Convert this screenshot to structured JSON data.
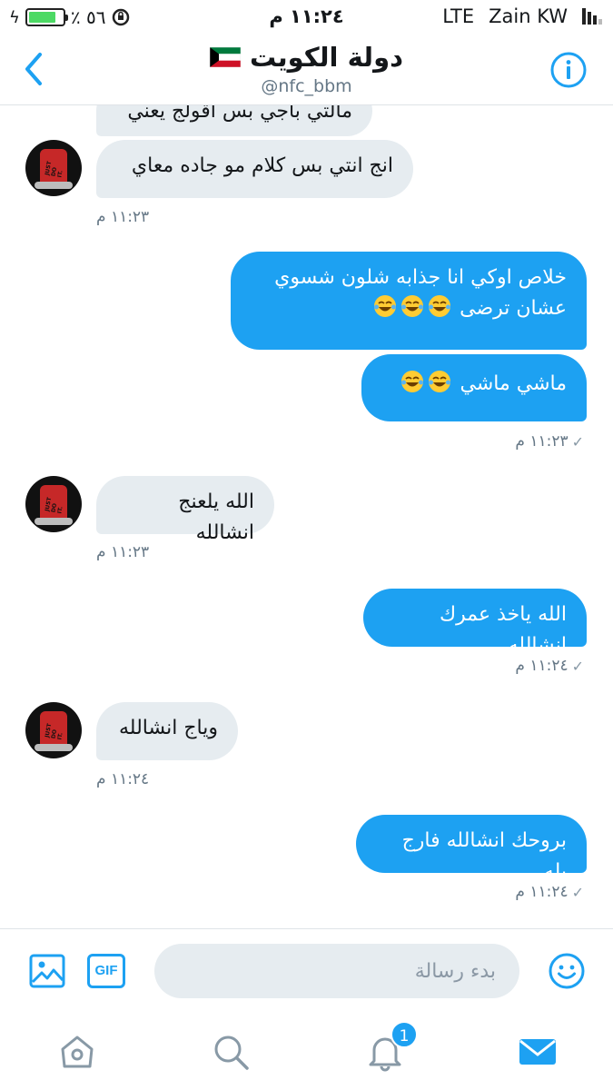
{
  "status_bar": {
    "battery_percent": "٪ ٥٦",
    "time": "١١:٢٤ م",
    "network": "LTE",
    "carrier": "Zain KW"
  },
  "header": {
    "title": "دولة الكويت",
    "handle": "@nfc_bbm"
  },
  "messages": [
    {
      "dir": "in",
      "text": "مالتي باجي بس اقولج يعني"
    },
    {
      "dir": "in",
      "text": "انج انتي بس كلام مو جاده معاي"
    },
    {
      "dir": "in_time",
      "text": "١١:٢٣ م"
    },
    {
      "dir": "out",
      "text_line1": "خلاص اوكي انا جذابه شلون شسوي",
      "text_line2": "عشان ترضى"
    },
    {
      "dir": "out",
      "text": "ماشي ماشي"
    },
    {
      "dir": "out_time",
      "text": "١١:٢٣ م"
    },
    {
      "dir": "in",
      "text": "الله يلعنج انشالله"
    },
    {
      "dir": "in_time",
      "text": "١١:٢٣ م"
    },
    {
      "dir": "out",
      "text": "الله ياخذ عمرك انشالله"
    },
    {
      "dir": "out_time",
      "text": "١١:٢٤ م"
    },
    {
      "dir": "in",
      "text": "وياج انشالله"
    },
    {
      "dir": "in_time",
      "text": "١١:٢٤ م"
    },
    {
      "dir": "out",
      "text": "بروحك انشالله فارج يله"
    },
    {
      "dir": "out_time",
      "text": "١١:٢٤ م"
    }
  ],
  "composer": {
    "gif_label": "GIF",
    "placeholder": "بدء رسالة"
  },
  "tabbar": {
    "notifications_badge": "1"
  },
  "colors": {
    "accent": "#1da1f2",
    "incoming_bubble": "#e6ecf0",
    "meta_text": "#657786"
  }
}
